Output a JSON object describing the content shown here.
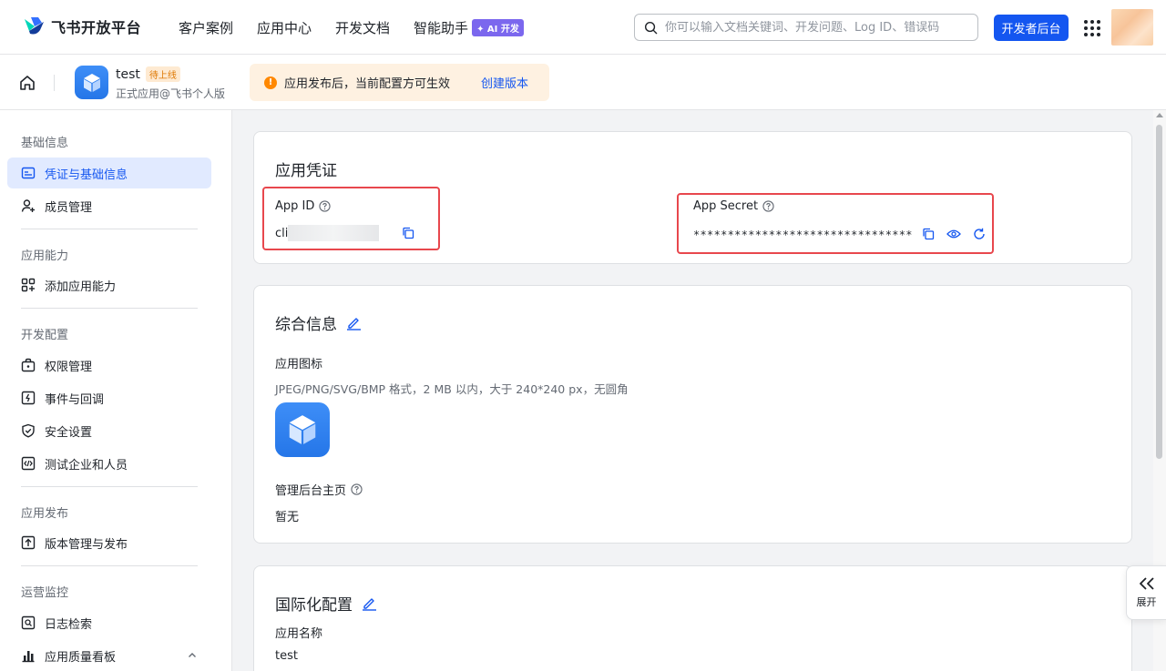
{
  "brand": {
    "name": "飞书开放平台"
  },
  "nav": {
    "items": [
      "客户案例",
      "应用中心",
      "开发文档",
      "智能助手"
    ],
    "ai_badge": "✦ AI 开发",
    "search_placeholder": "你可以输入文档关键词、开发问题、Log ID、错误码",
    "dev_console": "开发者后台"
  },
  "app": {
    "name": "test",
    "status_tag": "待上线",
    "subtitle": "正式应用@飞书个人版"
  },
  "notice": {
    "text": "应用发布后，当前配置方可生效",
    "link": "创建版本"
  },
  "sidebar": {
    "groups": [
      "基础信息",
      "应用能力",
      "开发配置",
      "应用发布",
      "运营监控"
    ],
    "items": [
      {
        "label": "凭证与基础信息",
        "icon": "credential-icon",
        "active": true
      },
      {
        "label": "成员管理",
        "icon": "member-add-icon"
      },
      {
        "label": "添加应用能力",
        "icon": "add-capability-icon"
      },
      {
        "label": "权限管理",
        "icon": "permission-icon"
      },
      {
        "label": "事件与回调",
        "icon": "event-icon"
      },
      {
        "label": "安全设置",
        "icon": "shield-icon"
      },
      {
        "label": "测试企业和人员",
        "icon": "code-icon"
      },
      {
        "label": "版本管理与发布",
        "icon": "upload-icon"
      },
      {
        "label": "日志检索",
        "icon": "log-search-icon"
      },
      {
        "label": "应用质量看板",
        "icon": "chart-icon"
      }
    ]
  },
  "credentials": {
    "title": "应用凭证",
    "app_id_label": "App ID",
    "app_id_visible": "cli",
    "app_secret_label": "App Secret",
    "app_secret_masked": "********************************"
  },
  "general": {
    "title": "综合信息",
    "icon_label": "应用图标",
    "icon_hint": "JPEG/PNG/SVG/BMP 格式，2 MB 以内，大于 240*240 px，无圆角",
    "homepage_label": "管理后台主页",
    "homepage_value": "暂无"
  },
  "i18n": {
    "title": "国际化配置",
    "name_label": "应用名称",
    "name_value": "test"
  },
  "expand": {
    "label": "展开"
  },
  "colors": {
    "primary": "#1456f0",
    "highlight_box": "#e8474d",
    "notice_bg": "#fef1e1"
  }
}
